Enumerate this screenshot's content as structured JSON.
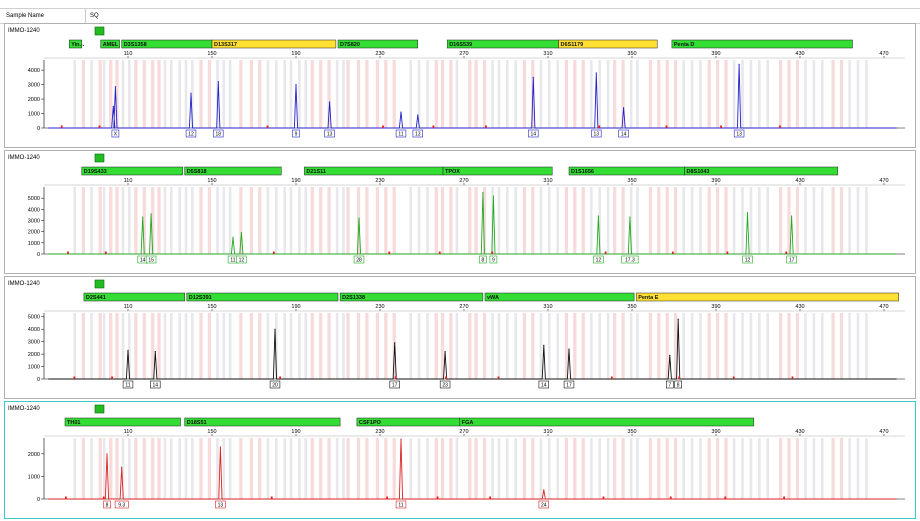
{
  "header": {
    "label": "Sample Name",
    "value": "SQ"
  },
  "x_axis": {
    "min": 70,
    "max": 480,
    "ticks": [
      110,
      150,
      190,
      230,
      270,
      310,
      350,
      390,
      430,
      470
    ]
  },
  "colors": {
    "marker_green": "#33dd33",
    "marker_yellow": "#ffe033",
    "blue": "#2222cc",
    "green": "#22aa22",
    "black": "#111111",
    "red": "#dd2222",
    "bin_red": "#f6d4d4",
    "bin_gray": "#e6e6ea",
    "panel_border": "#b0b0b0",
    "active_border": "#3cc8c8"
  },
  "chart_data": [
    {
      "type": "line",
      "sample": "IMMO-1240",
      "dye": "blue",
      "ylim": [
        0,
        4700
      ],
      "yticks": [
        0,
        1000,
        2000,
        3000,
        4000
      ],
      "markers": [
        {
          "label": "Yin...",
          "start": 82,
          "end": 88,
          "color": "green"
        },
        {
          "label": "AMEL",
          "start": 97,
          "end": 106,
          "color": "green"
        },
        {
          "label": "D3S1358",
          "start": 107,
          "end": 150,
          "color": "green"
        },
        {
          "label": "D13S317",
          "start": 150,
          "end": 209,
          "color": "yellow"
        },
        {
          "label": "D7S820",
          "start": 210,
          "end": 248,
          "color": "green"
        },
        {
          "label": "D16S539",
          "start": 262,
          "end": 315,
          "color": "green"
        },
        {
          "label": "D6S1179",
          "start": 315,
          "end": 362,
          "color": "yellow"
        },
        {
          "label": "Penta D",
          "start": 369,
          "end": 455,
          "color": "green"
        }
      ],
      "peaks": [
        {
          "x": 103,
          "h": 1500
        },
        {
          "x": 104,
          "h": 2850
        },
        {
          "x": 140,
          "h": 2400
        },
        {
          "x": 153,
          "h": 3200
        },
        {
          "x": 190,
          "h": 3000
        },
        {
          "x": 206,
          "h": 1800
        },
        {
          "x": 240,
          "h": 1100
        },
        {
          "x": 248,
          "h": 900
        },
        {
          "x": 303,
          "h": 3500
        },
        {
          "x": 333,
          "h": 3800
        },
        {
          "x": 346,
          "h": 1400
        },
        {
          "x": 401,
          "h": 4400
        }
      ],
      "allele_labels": [
        {
          "x": 104,
          "text": "X"
        },
        {
          "x": 140,
          "text": "12"
        },
        {
          "x": 153,
          "text": "18"
        },
        {
          "x": 190,
          "text": "9"
        },
        {
          "x": 206,
          "text": "13"
        },
        {
          "x": 240,
          "text": "11"
        },
        {
          "x": 248,
          "text": "13"
        },
        {
          "x": 303,
          "text": "14"
        },
        {
          "x": 333,
          "text": "13"
        },
        {
          "x": 346,
          "text": "14"
        },
        {
          "x": 401,
          "text": "13"
        }
      ]
    },
    {
      "type": "line",
      "sample": "IMMO-1240",
      "dye": "green",
      "ylim": [
        0,
        6000
      ],
      "yticks": [
        0,
        1000,
        2000,
        3000,
        4000,
        5000
      ],
      "markers": [
        {
          "label": "D19S433",
          "start": 88,
          "end": 136,
          "color": "green"
        },
        {
          "label": "D5S818",
          "start": 137,
          "end": 183,
          "color": "green"
        },
        {
          "label": "D21S11",
          "start": 194,
          "end": 260,
          "color": "green"
        },
        {
          "label": "TPOX",
          "start": 260,
          "end": 312,
          "color": "green"
        },
        {
          "label": "D1S1656",
          "start": 320,
          "end": 375,
          "color": "green"
        },
        {
          "label": "D8S1043",
          "start": 375,
          "end": 448,
          "color": "green"
        }
      ],
      "peaks": [
        {
          "x": 117,
          "h": 3300
        },
        {
          "x": 121,
          "h": 3600
        },
        {
          "x": 160,
          "h": 1500
        },
        {
          "x": 164,
          "h": 1900
        },
        {
          "x": 220,
          "h": 3200
        },
        {
          "x": 279,
          "h": 5500
        },
        {
          "x": 284,
          "h": 5200
        },
        {
          "x": 334,
          "h": 3400
        },
        {
          "x": 349,
          "h": 3300
        },
        {
          "x": 405,
          "h": 3700
        },
        {
          "x": 426,
          "h": 3400
        }
      ],
      "allele_labels": [
        {
          "x": 117,
          "text": "14"
        },
        {
          "x": 121,
          "text": "15"
        },
        {
          "x": 160,
          "text": "11"
        },
        {
          "x": 164,
          "text": "12"
        },
        {
          "x": 220,
          "text": "28"
        },
        {
          "x": 279,
          "text": "8"
        },
        {
          "x": 284,
          "text": "9"
        },
        {
          "x": 334,
          "text": "12"
        },
        {
          "x": 349,
          "text": "17.3"
        },
        {
          "x": 405,
          "text": "12"
        },
        {
          "x": 426,
          "text": "17"
        }
      ]
    },
    {
      "type": "line",
      "sample": "IMMO-1240",
      "dye": "black",
      "ylim": [
        0,
        5300
      ],
      "yticks": [
        0,
        1000,
        2000,
        3000,
        4000,
        5000
      ],
      "markers": [
        {
          "label": "D2S441",
          "start": 89,
          "end": 137,
          "color": "green"
        },
        {
          "label": "D12S391",
          "start": 138,
          "end": 210,
          "color": "green"
        },
        {
          "label": "D2S1338",
          "start": 211,
          "end": 279,
          "color": "green"
        },
        {
          "label": "vWA",
          "start": 280,
          "end": 351,
          "color": "green"
        },
        {
          "label": "Penta E",
          "start": 352,
          "end": 477,
          "color": "yellow"
        }
      ],
      "peaks": [
        {
          "x": 110,
          "h": 2300
        },
        {
          "x": 123,
          "h": 2200
        },
        {
          "x": 180,
          "h": 4000
        },
        {
          "x": 237,
          "h": 2900
        },
        {
          "x": 261,
          "h": 2200
        },
        {
          "x": 308,
          "h": 2700
        },
        {
          "x": 320,
          "h": 2400
        },
        {
          "x": 368,
          "h": 1900
        },
        {
          "x": 372,
          "h": 4800
        }
      ],
      "allele_labels": [
        {
          "x": 110,
          "text": "11"
        },
        {
          "x": 123,
          "text": "14"
        },
        {
          "x": 180,
          "text": "20"
        },
        {
          "x": 237,
          "text": "17"
        },
        {
          "x": 261,
          "text": "23"
        },
        {
          "x": 308,
          "text": "14"
        },
        {
          "x": 320,
          "text": "17"
        },
        {
          "x": 368,
          "text": "7"
        },
        {
          "x": 372,
          "text": "8"
        }
      ]
    },
    {
      "type": "line",
      "sample": "IMMO-1240",
      "dye": "red",
      "ylim": [
        0,
        2700
      ],
      "yticks": [
        0,
        1000,
        2000
      ],
      "markers": [
        {
          "label": "TH01",
          "start": 80,
          "end": 135,
          "color": "green"
        },
        {
          "label": "D18S51",
          "start": 137,
          "end": 211,
          "color": "green"
        },
        {
          "label": "CSF1PO",
          "start": 219,
          "end": 268,
          "color": "green"
        },
        {
          "label": "FGA",
          "start": 268,
          "end": 408,
          "color": "green"
        }
      ],
      "peaks": [
        {
          "x": 100,
          "h": 2000
        },
        {
          "x": 107,
          "h": 1400
        },
        {
          "x": 154,
          "h": 2300
        },
        {
          "x": 240,
          "h": 2650
        },
        {
          "x": 308,
          "h": 400
        }
      ],
      "allele_labels": [
        {
          "x": 100,
          "text": "8"
        },
        {
          "x": 107,
          "text": "9.3"
        },
        {
          "x": 154,
          "text": "13"
        },
        {
          "x": 240,
          "text": "11"
        },
        {
          "x": 308,
          "text": "24"
        }
      ]
    }
  ]
}
